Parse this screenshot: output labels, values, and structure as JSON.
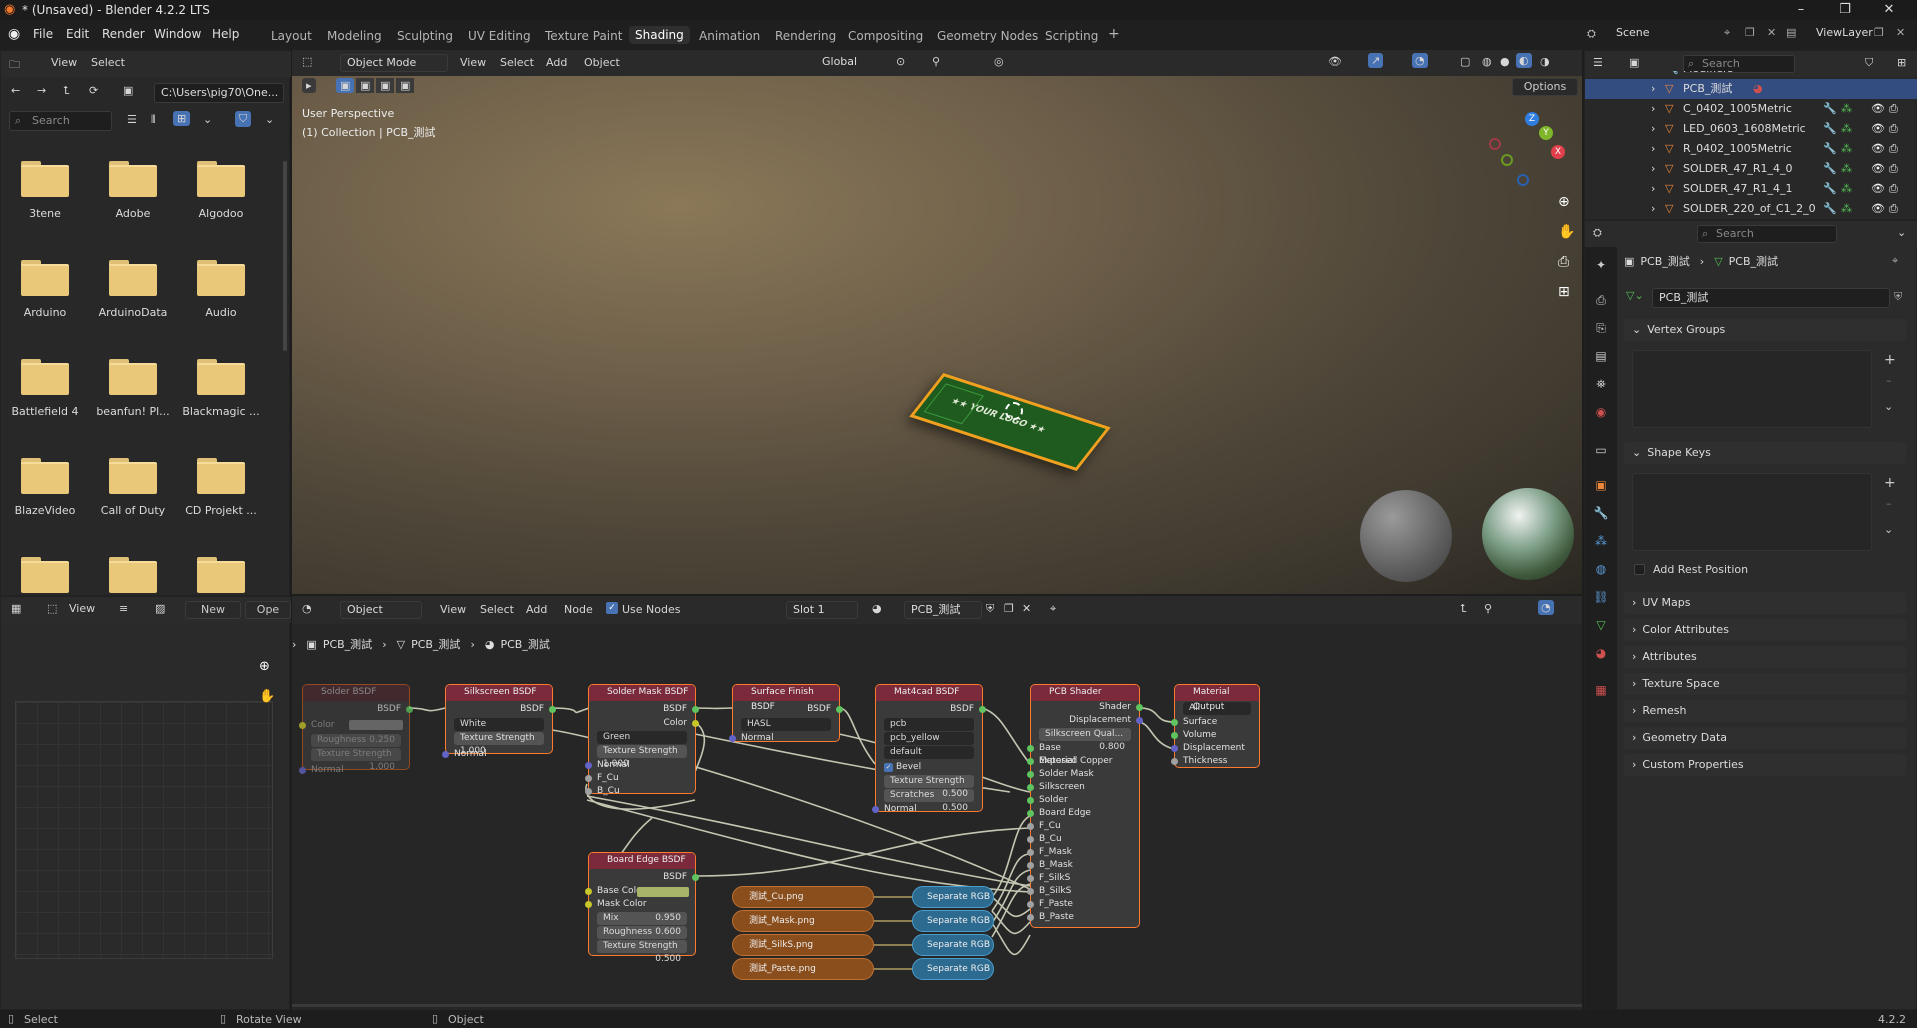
{
  "window": {
    "title": "* (Unsaved) - Blender 4.2.2 LTS",
    "controls": [
      "–",
      "❐",
      "✕"
    ]
  },
  "menu": [
    "File",
    "Edit",
    "Render",
    "Window",
    "Help"
  ],
  "workspaces": {
    "tabs": [
      "Layout",
      "Modeling",
      "Sculpting",
      "UV Editing",
      "Texture Paint",
      "Shading",
      "Animation",
      "Rendering",
      "Compositing",
      "Geometry Nodes",
      "Scripting"
    ],
    "active": "Shading",
    "add": "+"
  },
  "scene": {
    "name": "Scene",
    "view_layer": "ViewLayer"
  },
  "file_browser": {
    "header": {
      "view": "View",
      "select": "Select"
    },
    "path": "C:\\Users\\pig70\\One...",
    "search_placeholder": "Search",
    "folders": [
      "3tene",
      "Adobe",
      "Algodoo",
      "Arduino",
      "ArduinoData",
      "Audio",
      "Battlefield 4",
      "beanfun! Pl...",
      "Blackmagic ...",
      "BlazeVideo",
      "Call of Duty",
      "CD Projekt ..."
    ]
  },
  "viewport": {
    "mode": "Object Mode",
    "menus": [
      "View",
      "Select",
      "Add",
      "Object"
    ],
    "transform": "Global",
    "options": "Options",
    "overlay_line1": "User Perspective",
    "overlay_line2": "(1) Collection | PCB_測試",
    "pcb_label": "★★ YOUR LOGO ★★",
    "gizmo_axes": [
      "Z",
      "Y",
      "X"
    ]
  },
  "image_editor": {
    "view": "View",
    "new": "New",
    "open": "Ope"
  },
  "node_editor": {
    "object": "Object",
    "menus": [
      "View",
      "Select",
      "Add",
      "Node"
    ],
    "use_nodes": "Use Nodes",
    "slot": "Slot 1",
    "material": "PCB_測試",
    "breadcrumb": [
      "PCB_測試",
      "PCB_測試",
      "PCB_測試"
    ],
    "nodes": {
      "solder": {
        "title": "Solder BSDF",
        "out": "BSDF",
        "color": "Color",
        "roughness": "Roughness",
        "roughness_val": "0.250",
        "texture": "Texture Strength",
        "texture_val": "1.000",
        "normal": "Normal"
      },
      "silkscreen": {
        "title": "Silkscreen BSDF",
        "out": "BSDF",
        "dropdown": "White",
        "texture": "Texture Strength",
        "texture_val": "1.000",
        "normal": "Normal"
      },
      "soldermask": {
        "title": "Solder Mask BSDF",
        "out_bsdf": "BSDF",
        "out_color": "Color",
        "dropdown": "Green",
        "texture": "Texture Strength",
        "texture_val": "1.000",
        "normal": "Normal",
        "fcu": "F_Cu",
        "bcu": "B_Cu"
      },
      "surface": {
        "title": "Surface Finish BSDF",
        "out": "BSDF",
        "dropdown": "HASL",
        "normal": "Normal"
      },
      "mat4cad": {
        "title": "Mat4cad BSDF",
        "out": "BSDF",
        "dd1": "pcb",
        "dd2": "pcb_yellow",
        "dd3": "default",
        "bevel": "Bevel",
        "texture": "Texture Strength",
        "texture_val": "0.500",
        "scratches": "Scratches",
        "scratches_val": "0.500",
        "normal": "Normal"
      },
      "pcbshader": {
        "title": "PCB Shader",
        "out_shader": "Shader",
        "out_disp": "Displacement",
        "silk_q": "Silkscreen Qual...",
        "silk_q_val": "0.800",
        "inputs": [
          "Base Material",
          "Exposed Copper",
          "Solder Mask",
          "Silkscreen",
          "Solder",
          "Board Edge",
          "F_Cu",
          "B_Cu",
          "F_Mask",
          "B_Mask",
          "F_SilkS",
          "B_SilkS",
          "F_Paste",
          "B_Paste"
        ]
      },
      "output": {
        "title": "Material Output",
        "dropdown": "All",
        "inputs": [
          "Surface",
          "Volume",
          "Displacement",
          "Thickness"
        ]
      },
      "boardedge": {
        "title": "Board Edge BSDF",
        "out": "BSDF",
        "base_color": "Base Color",
        "mask_color": "Mask Color",
        "mix": "Mix",
        "mix_val": "0.950",
        "roughness": "Roughness",
        "roughness_val": "0.600",
        "texture": "Texture Strength",
        "texture_val": "0.500",
        "normal": "Normal"
      },
      "images": [
        "測試_Cu.png",
        "測試_Mask.png",
        "測試_SilkS.png",
        "測試_Paste.png"
      ],
      "separate": "Separate RGB (Le..."
    }
  },
  "outliner": {
    "search_placeholder": "Search",
    "rows": [
      {
        "name": "Modifiers",
        "selected": false
      },
      {
        "name": "PCB_測試",
        "selected": true
      },
      {
        "name": "C_0402_1005Metric",
        "selected": false
      },
      {
        "name": "LED_0603_1608Metric",
        "selected": false
      },
      {
        "name": "R_0402_1005Metric",
        "selected": false
      },
      {
        "name": "SOLDER_47_R1_4_0",
        "selected": false
      },
      {
        "name": "SOLDER_47_R1_4_1",
        "selected": false
      },
      {
        "name": "SOLDER_220_of_C1_2_0",
        "selected": false
      }
    ]
  },
  "properties": {
    "search_placeholder": "Search",
    "breadcrumb": [
      "PCB_測試",
      "PCB_測試"
    ],
    "mesh_name": "PCB_測試",
    "sections": {
      "vertex_groups": "Vertex Groups",
      "shape_keys": "Shape Keys",
      "add_rest": "Add Rest Position",
      "collapsed": [
        "UV Maps",
        "Color Attributes",
        "Attributes",
        "Texture Space",
        "Remesh",
        "Geometry Data",
        "Custom Properties"
      ]
    }
  },
  "statusbar": {
    "select": "Select",
    "rotate": "Rotate View",
    "object": "Object",
    "version": "4.2.2"
  },
  "colors": {
    "accent": "#4772b3",
    "node_border": "#ff7a2e",
    "selected_row": "#334d80",
    "folder": "#e9c87a"
  }
}
